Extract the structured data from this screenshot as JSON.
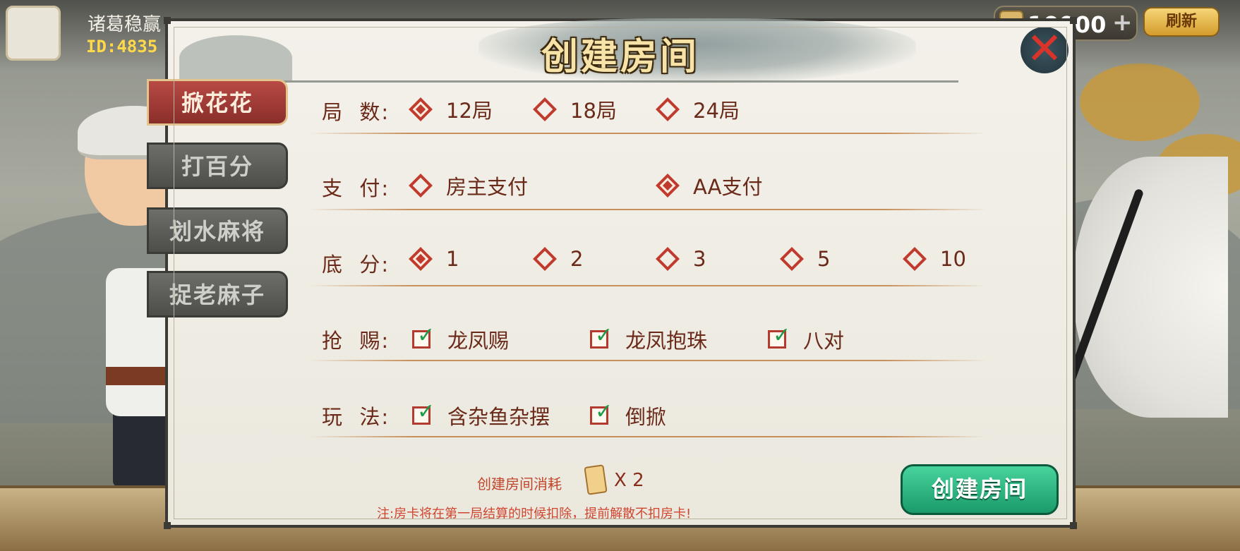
{
  "topbar": {
    "player_name": "诸葛稳赢",
    "player_id": "ID:4835",
    "coins": "10000",
    "refresh_label": "刷新"
  },
  "dialog": {
    "title": "创建房间",
    "close_icon": "close-x-icon"
  },
  "tabs": [
    {
      "label": "掀花花",
      "active": true
    },
    {
      "label": "打百分",
      "active": false
    },
    {
      "label": "划水麻将",
      "active": false
    },
    {
      "label": "捉老麻子",
      "active": false
    }
  ],
  "options": {
    "rounds": {
      "label": "局  数:",
      "choices": [
        {
          "label": "12局",
          "selected": true
        },
        {
          "label": "18局",
          "selected": false
        },
        {
          "label": "24局",
          "selected": false
        }
      ]
    },
    "payment": {
      "label": "支  付:",
      "choices": [
        {
          "label": "房主支付",
          "selected": false
        },
        {
          "label": "AA支付",
          "selected": true
        }
      ]
    },
    "base_score": {
      "label": "底  分:",
      "choices": [
        {
          "label": "1",
          "selected": true
        },
        {
          "label": "2",
          "selected": false
        },
        {
          "label": "3",
          "selected": false
        },
        {
          "label": "5",
          "selected": false
        },
        {
          "label": "10",
          "selected": false
        }
      ]
    },
    "grab": {
      "label": "抢  赐:",
      "choices": [
        {
          "label": "龙凤赐",
          "checked": true
        },
        {
          "label": "龙凤抱珠",
          "checked": true
        },
        {
          "label": "八对",
          "checked": true
        }
      ]
    },
    "play_mode": {
      "label": "玩  法:",
      "choices": [
        {
          "label": "含杂鱼杂摆",
          "checked": true
        },
        {
          "label": "倒掀",
          "checked": true
        }
      ]
    }
  },
  "footer": {
    "cost_label": "创建房间消耗",
    "cost_count": "X 2",
    "note": "注:房卡将在第一局结算的时候扣除，提前解散不扣房卡!",
    "create_button": "创建房间"
  },
  "colors": {
    "accent_red": "#c13a2e",
    "label_brown": "#6b2a19",
    "create_green": "#1a9a6a",
    "tab_active": "#b84a44"
  }
}
